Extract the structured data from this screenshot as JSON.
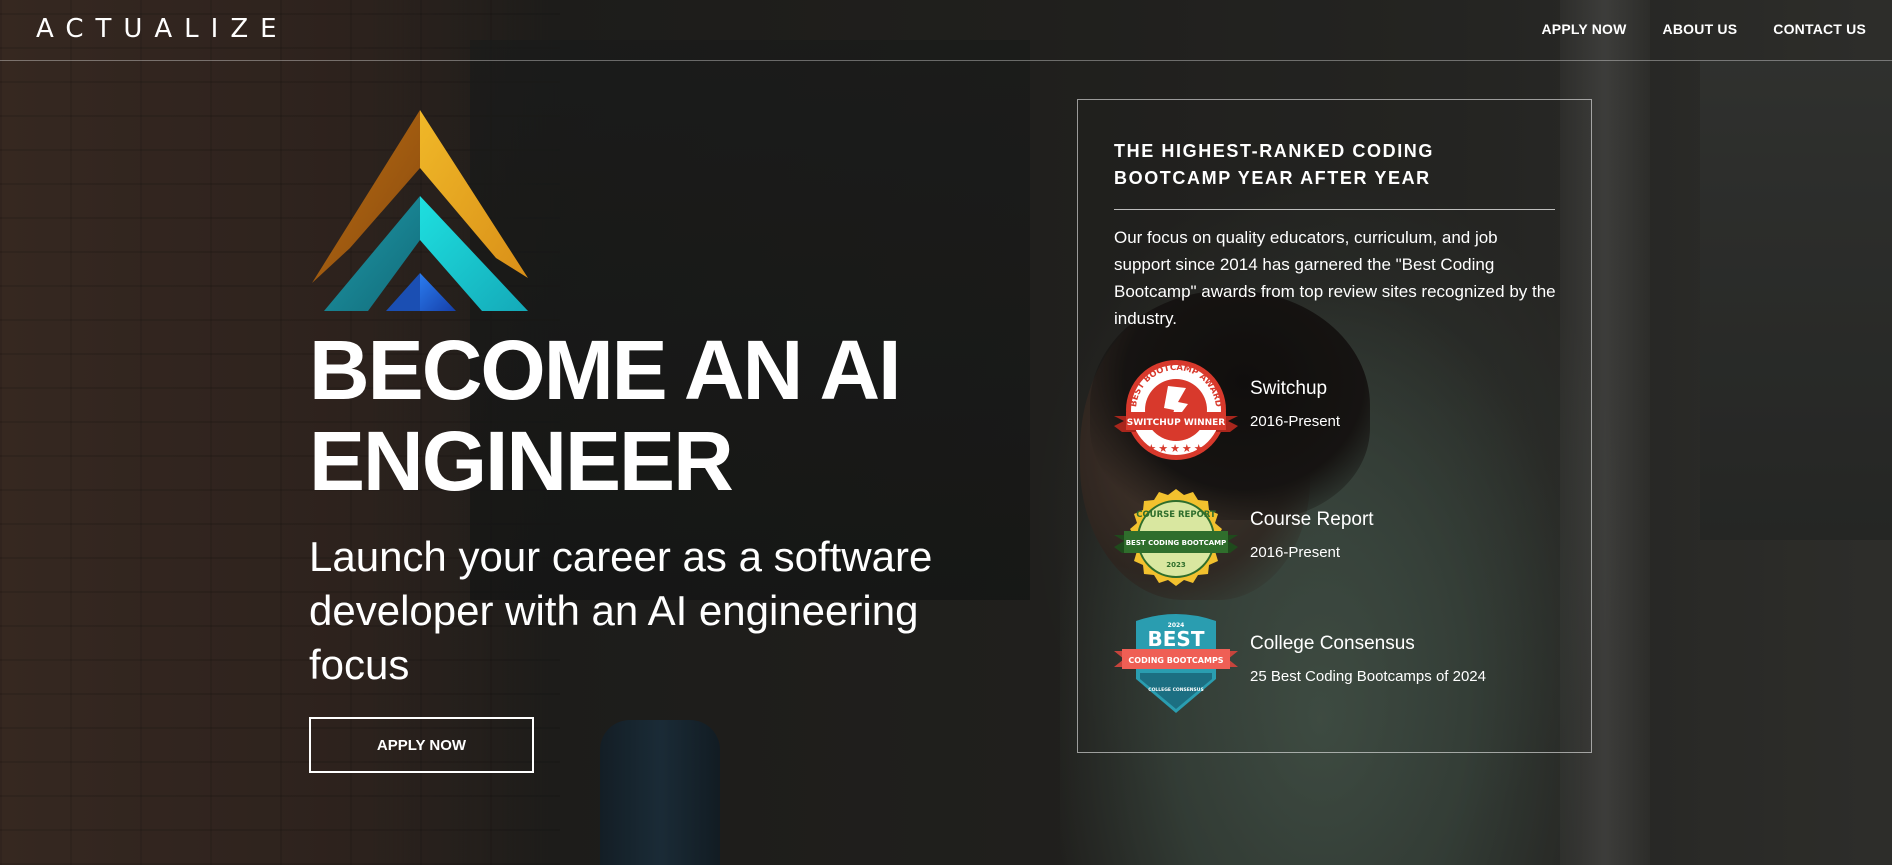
{
  "header": {
    "brand": "ACTUALIZE",
    "nav": [
      {
        "label": "APPLY NOW"
      },
      {
        "label": "ABOUT US"
      },
      {
        "label": "CONTACT US"
      }
    ]
  },
  "hero": {
    "title_line1": "BECOME AN AI",
    "title_line2": "ENGINEER",
    "subtitle": "Launch your career as a software developer with an AI engineering focus",
    "cta_label": "APPLY NOW"
  },
  "panel": {
    "heading": "THE HIGHEST-RANKED CODING BOOTCAMP YEAR AFTER YEAR",
    "description": "Our focus on quality educators, curriculum, and job support since 2014 has garnered the \"Best Coding Bootcamp\" awards from top review sites recognized by the industry.",
    "awards": [
      {
        "name": "Switchup",
        "period": "2016-Present",
        "badge_arc_text": "BEST BOOTCAMP AWARD",
        "badge_ribbon_text": "SWITCHUP WINNER",
        "icon": "switchup-award-badge"
      },
      {
        "name": "Course Report",
        "period": "2016-Present",
        "badge_top_text": "COURSE REPORT",
        "badge_ribbon_text": "BEST CODING BOOTCAMP",
        "badge_year": "2023",
        "icon": "course-report-award-badge"
      },
      {
        "name": "College Consensus",
        "period": "25 Best Coding Bootcamps of 2024",
        "badge_year": "2024",
        "badge_title": "BEST",
        "badge_ribbon_text": "CODING BOOTCAMPS",
        "badge_footer_text": "COLLEGE CONSENSUS",
        "icon": "college-consensus-award-badge"
      }
    ]
  },
  "colors": {
    "logo_orange": "#e0a020",
    "logo_teal": "#18b8c0",
    "logo_blue": "#1c5fd0",
    "switchup_red": "#d8392c",
    "course_report_yellow": "#f2c12e",
    "course_report_green": "#2f6e2c",
    "college_consensus_teal": "#2a9db0",
    "college_consensus_coral": "#ef5f55"
  }
}
